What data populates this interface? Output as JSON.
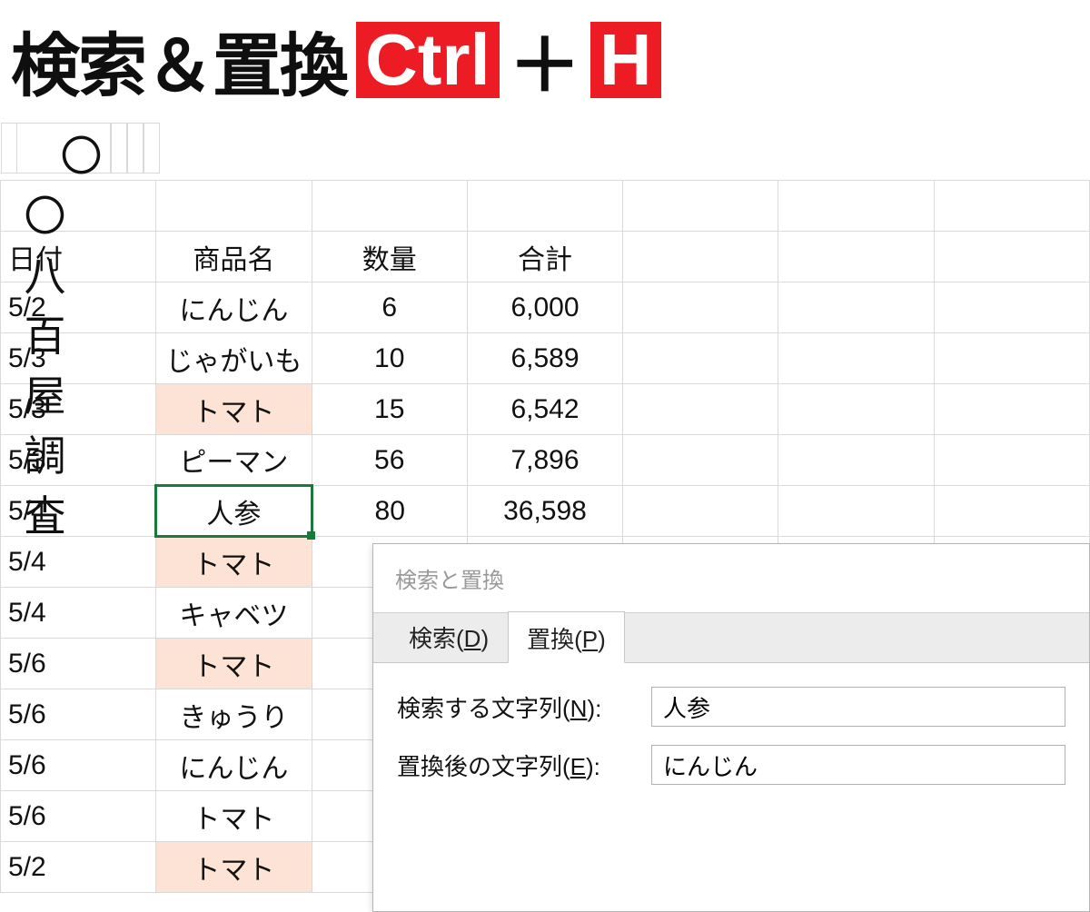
{
  "banner": {
    "title": "検索＆置換",
    "key1": "Ctrl",
    "plus": "＋",
    "key2": "H"
  },
  "sheet": {
    "title": "〇〇八百屋 調査",
    "headers": {
      "date": "日付",
      "name": "商品名",
      "qty": "数量",
      "total": "合計"
    },
    "rows": [
      {
        "date": "5/2",
        "name": "にんじん",
        "qty": "6",
        "total": "6,000",
        "hl": false
      },
      {
        "date": "5/3",
        "name": "じゃがいも",
        "qty": "10",
        "total": "6,589",
        "hl": false
      },
      {
        "date": "5/3",
        "name": "トマト",
        "qty": "15",
        "total": "6,542",
        "hl": true
      },
      {
        "date": "5/3",
        "name": "ピーマン",
        "qty": "56",
        "total": "7,896",
        "hl": false
      },
      {
        "date": "5/4",
        "name": "人参",
        "qty": "80",
        "total": "36,598",
        "hl": false,
        "selected": true
      },
      {
        "date": "5/4",
        "name": "トマト",
        "qty": "",
        "total": "",
        "hl": true
      },
      {
        "date": "5/4",
        "name": "キャベツ",
        "qty": "",
        "total": "",
        "hl": false
      },
      {
        "date": "5/6",
        "name": "トマト",
        "qty": "",
        "total": "",
        "hl": true
      },
      {
        "date": "5/6",
        "name": "きゅうり",
        "qty": "",
        "total": "",
        "hl": false
      },
      {
        "date": "5/6",
        "name": "にんじん",
        "qty": "",
        "total": "",
        "hl": false
      },
      {
        "date": "5/6",
        "name": "トマト",
        "qty": "",
        "total": "",
        "hl": false
      },
      {
        "date": "5/2",
        "name": "トマト",
        "qty": "",
        "total": "",
        "hl": true
      }
    ]
  },
  "dialog": {
    "title": "検索と置換",
    "tabs": {
      "search": "検索(D)",
      "replace": "置換(P)"
    },
    "labels": {
      "find": "検索する文字列(N):",
      "replace": "置換後の文字列(E):"
    },
    "values": {
      "find": "人参",
      "replace": "にんじん"
    }
  }
}
